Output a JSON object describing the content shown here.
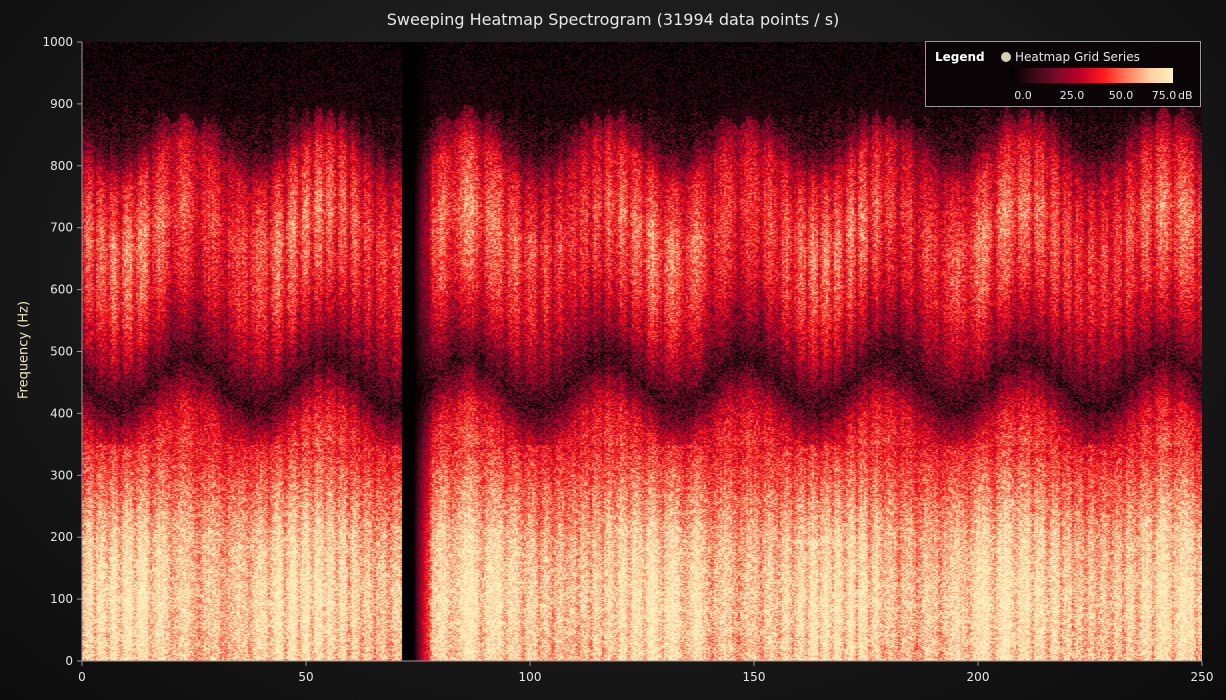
{
  "chart_data": {
    "type": "heatmap",
    "title": "Sweeping Heatmap Spectrogram (31994 data points / s)",
    "xlabel": "",
    "ylabel": "Frequency (Hz)",
    "xlim": [
      0,
      250
    ],
    "ylim": [
      0,
      1000
    ],
    "x_ticks": [
      "0",
      "50",
      "100",
      "150",
      "200",
      "250"
    ],
    "y_ticks": [
      "0",
      "100",
      "200",
      "300",
      "400",
      "500",
      "600",
      "700",
      "800",
      "900",
      "1000"
    ],
    "sweep_position_x": 71.5,
    "value_range": [
      0,
      85
    ],
    "value_unit": "dB",
    "colormap": [
      "#000000",
      "#3a0a18",
      "#7a0a2a",
      "#c00028",
      "#ff1a1a",
      "#ff7a5a",
      "#ffd0a0",
      "#fff0c0"
    ],
    "typical_profile": [
      {
        "frequency": 0,
        "db": 72
      },
      {
        "frequency": 100,
        "db": 75
      },
      {
        "frequency": 200,
        "db": 70
      },
      {
        "frequency": 300,
        "db": 55
      },
      {
        "frequency": 380,
        "db": 40
      },
      {
        "frequency": 450,
        "db": 12
      },
      {
        "frequency": 520,
        "db": 30
      },
      {
        "frequency": 600,
        "db": 45
      },
      {
        "frequency": 700,
        "db": 52
      },
      {
        "frequency": 800,
        "db": 38
      },
      {
        "frequency": 870,
        "db": 10
      },
      {
        "frequency": 1000,
        "db": 0
      }
    ],
    "legend": {
      "title": "Legend",
      "series": "Heatmap Grid Series",
      "ticks": [
        "0.0",
        "25.0",
        "50.0",
        "75.0"
      ],
      "unit": "dB"
    }
  }
}
